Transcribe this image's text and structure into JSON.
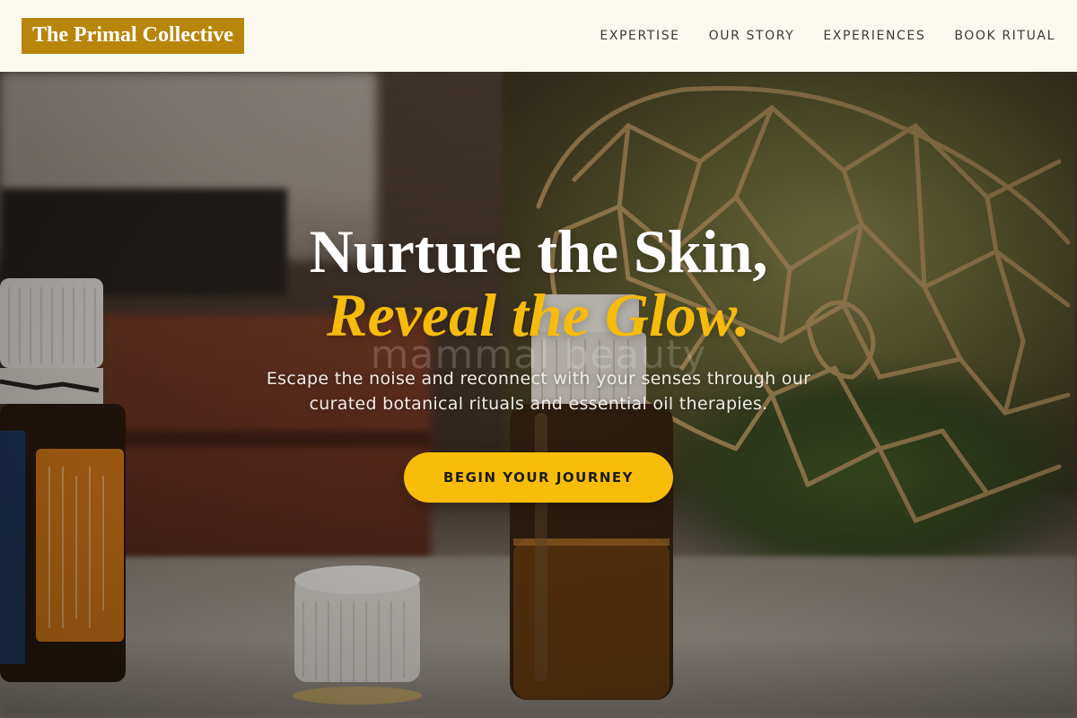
{
  "header": {
    "logo_text": "The Primal Collective",
    "nav": [
      {
        "label": "EXPERTISE"
      },
      {
        "label": "OUR STORY"
      },
      {
        "label": "EXPERIENCES"
      },
      {
        "label": "BOOK RITUAL"
      }
    ]
  },
  "hero": {
    "headline_line1": "Nurture the Skin,",
    "headline_line2": "Reveal the Glow.",
    "watermark": "mammal beauty",
    "subtext": "Escape the noise and reconnect with your senses through our curated botanical rituals and essential oil therapies.",
    "cta_label": "BEGIN YOUR JOURNEY",
    "background_image": "essential-oil-bottles-photo"
  },
  "colors": {
    "brand_gold": "#b8860b",
    "accent_yellow": "#f6bb0b",
    "header_bg": "#fbf8ef",
    "nav_text": "#3a3a3a"
  }
}
